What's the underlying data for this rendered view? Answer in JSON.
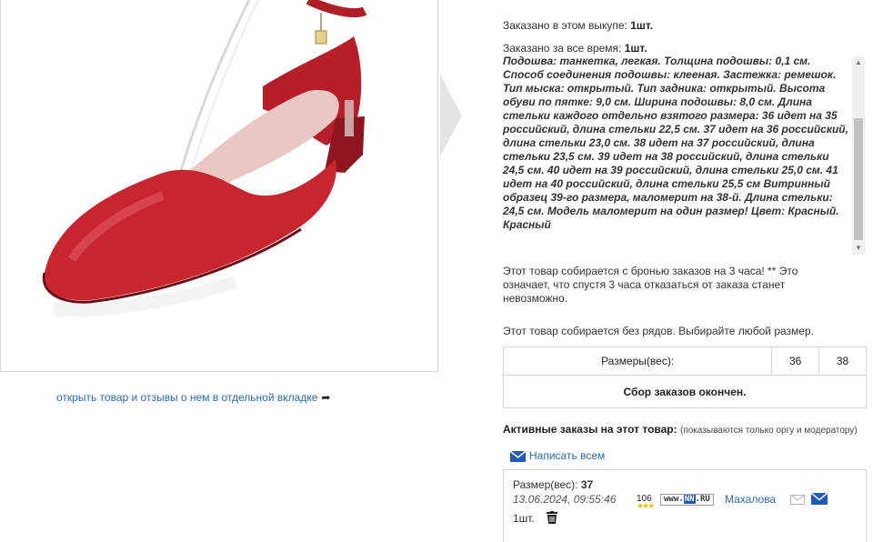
{
  "product_image": {
    "alt": "red-pointed-toe-ankle-strap-shoe"
  },
  "open_link": {
    "label": "открыть товар и отзывы о нем в отдельной вкладке",
    "arrow": "➦"
  },
  "stats": {
    "ordered_this_buy_label": "Заказано в этом выкупе:",
    "ordered_this_buy_value": "1шт.",
    "ordered_all_time_label": "Заказано за все время:",
    "ordered_all_time_value": "1шт."
  },
  "description": "Подошва: танкетка, легкая. Толщина подошвы: 0,1 см. Способ соединения подошвы: клееная. Застежка: ремешок. Тип мыска: открытый. Тип задника: открытый. Высота обуви по пятке: 9,0 см. Ширина подошвы: 8,0 см. Длина стельки каждого отдельно взятого размера: 36 идет на 35 российский, длина стельки 22,5 см.  37 идет на 36 российский, длина стельки 23,0 см.  38 идет на 37 российский, длина стельки 23,5 см.  39 идет на 38 российский, длина стельки 24,5 см.  40 идет на 39 российский, длина стельки 25,0 см.  41 идет на 40 российский, длина стельки 25,5 см Витринный образец 39-го размера, маломерит на 38-й. Длина стельки: 24,5 см. Модель маломерит на один размер! Цвет: Красный. Красный",
  "notice_reservation": "Этот товар собирается с бронью заказов на 3 часа! ** Это означает, что спустя 3 часа отказаться от заказа станет невозможно.",
  "notice_rows": "Этот товар собирается без рядов. Выбирайте любой размер.",
  "sizes_table": {
    "header": "Размеры(вес):",
    "sizes": [
      "36",
      "38"
    ],
    "status": "Сбор заказов окончен."
  },
  "active_orders": {
    "title": "Активные заказы на этот товар:",
    "note": "(показываются только оргу и модератору)",
    "write_all": "Написать всем"
  },
  "order": {
    "size_label": "Размер(вес):",
    "size_value": "37",
    "datetime": "13.06.2024, 09:55:46",
    "rating": "106",
    "site_logo": {
      "prefix": "www.",
      "nn": "NN",
      "suffix": ".RU"
    },
    "username": "Махалова",
    "quantity": "1шт."
  },
  "colors": {
    "link": "#2a6bb1",
    "shoe_red": "#c8252f",
    "border": "#d6d6d6"
  }
}
